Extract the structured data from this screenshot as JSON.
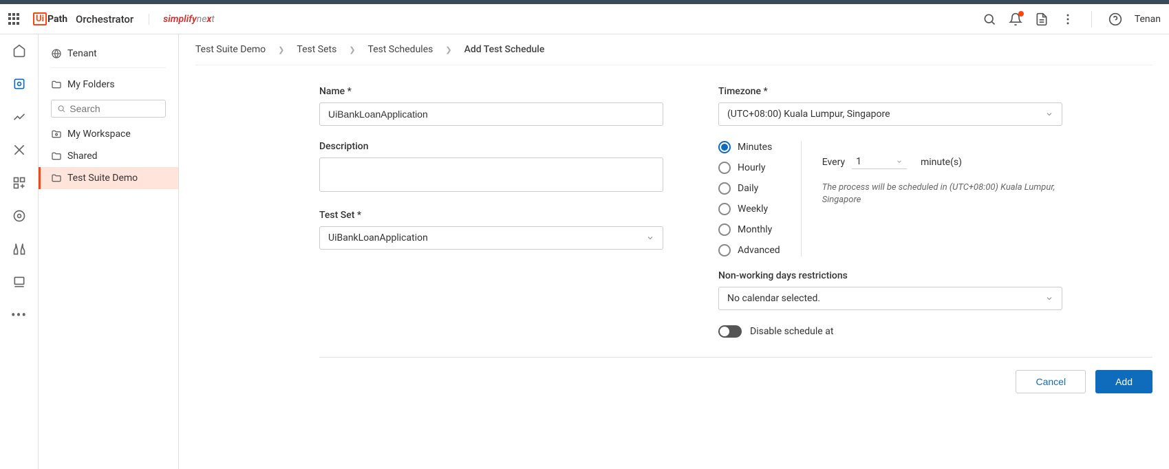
{
  "header": {
    "logo_brackets": "Ui",
    "logo_text": "Path",
    "product": "Orchestrator",
    "partner_s1": "simplify",
    "partner_s2": "ne",
    "partner_s3": "x",
    "partner_s4": "t",
    "tenant_label": "Tenan"
  },
  "folders": {
    "tenant": "Tenant",
    "my_folders": "My Folders",
    "search_placeholder": "Search",
    "items": [
      {
        "label": "My Workspace"
      },
      {
        "label": "Shared"
      },
      {
        "label": "Test Suite Demo"
      }
    ]
  },
  "breadcrumb": {
    "items": [
      "Test Suite Demo",
      "Test Sets",
      "Test Schedules",
      "Add Test Schedule"
    ]
  },
  "form": {
    "name_label": "Name *",
    "name_value": "UiBankLoanApplication",
    "description_label": "Description",
    "description_value": "",
    "testset_label": "Test Set *",
    "testset_value": "UiBankLoanApplication",
    "timezone_label": "Timezone *",
    "timezone_value": "(UTC+08:00) Kuala Lumpur, Singapore",
    "frequency": {
      "options": [
        "Minutes",
        "Hourly",
        "Daily",
        "Weekly",
        "Monthly",
        "Advanced"
      ],
      "every_label": "Every",
      "every_value": "1",
      "unit_label": "minute(s)",
      "note": "The process will be scheduled in (UTC+08:00) Kuala Lumpur, Singapore"
    },
    "nonworking_label": "Non-working days restrictions",
    "nonworking_value": "No calendar selected.",
    "disable_label": "Disable schedule at"
  },
  "actions": {
    "cancel": "Cancel",
    "add": "Add"
  }
}
